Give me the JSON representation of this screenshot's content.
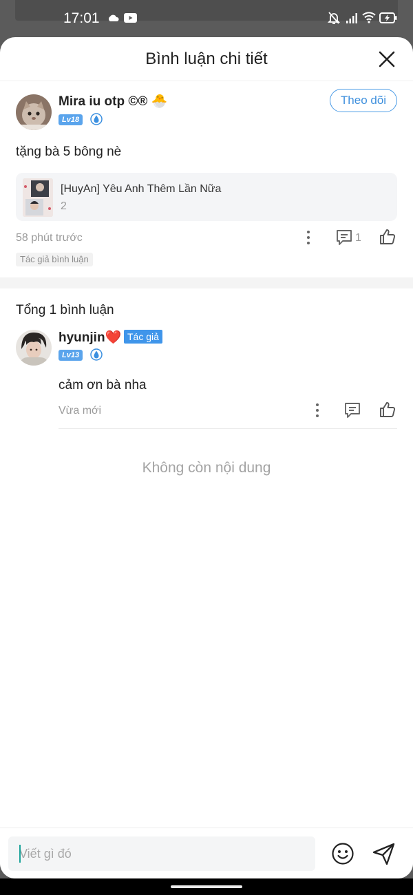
{
  "status_bar": {
    "time": "17:01",
    "icons": [
      "cloud-icon",
      "youtube-icon",
      "bell-off-icon",
      "signal-icon",
      "wifi-icon",
      "battery-charging-icon"
    ]
  },
  "sheet": {
    "title": "Bình luận chi tiết",
    "close_icon": "close-icon"
  },
  "main_comment": {
    "author": "Mira iu otp ©®",
    "author_emoji": "🐣",
    "level": "Lv18",
    "follow_label": "Theo dõi",
    "text": "tặng bà 5 bông nè",
    "book": {
      "title": "[HuyAn] Yêu Anh Thêm Lần Nữa",
      "sub": "2"
    },
    "time": "58 phút trước",
    "reply_count": "1",
    "tag": "Tác giả bình luận"
  },
  "replies": {
    "total_label": "Tổng 1 bình luận",
    "items": [
      {
        "author": "hyunjin",
        "author_emoji": "❤️",
        "author_tag": "Tác giả",
        "level": "Lv13",
        "text": "cảm ơn bà nha",
        "time": "Vừa mới"
      }
    ],
    "end_label": "Không còn nội dung"
  },
  "input": {
    "placeholder": "Viết gì đó",
    "value": ""
  },
  "colors": {
    "accent": "#4a9be6",
    "level_badge": "#5aa4ec",
    "author_tag": "#3f95ea"
  }
}
